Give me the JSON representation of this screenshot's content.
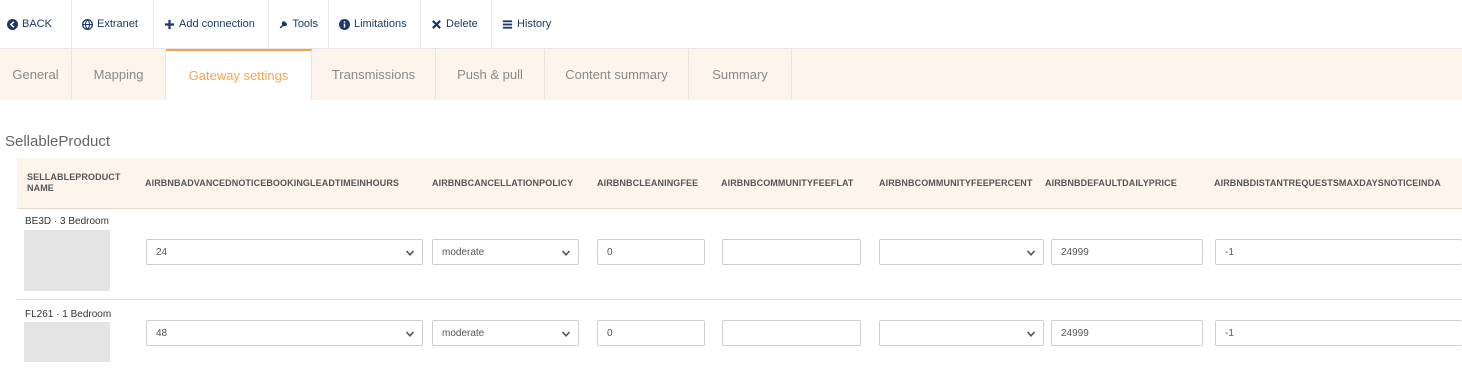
{
  "toolbar": {
    "back": "BACK",
    "extranet": "Extranet",
    "add_connection": "Add connection",
    "tools": "Tools",
    "limitations": "Limitations",
    "delete": "Delete",
    "history": "History"
  },
  "tabs": [
    "General",
    "Mapping",
    "Gateway settings",
    "Transmissions",
    "Push & pull",
    "Content summary",
    "Summary"
  ],
  "active_tab": "Gateway settings",
  "section_title": "SellableProduct",
  "columns": [
    "SELLABLEPRODUCT NAME",
    "AIRBNBADVANCEDNOTICEBOOKINGLEADTIMEINHOURS",
    "AIRBNBCANCELLATIONPOLICY",
    "AIRBNBCLEANINGFEE",
    "AIRBNBCOMMUNITYFEEFLAT",
    "AIRBNBCOMMUNITYFEEPERCENT",
    "AIRBNBDEFAULTDAILYPRICE",
    "AIRBNBDISTANTREQUESTSMAXDAYSNOTICEINDA"
  ],
  "rows": [
    {
      "name": "BE3D · 3 Bedroom",
      "lead_time": "24",
      "cancellation": "moderate",
      "cleaning_fee": "0",
      "community_fee_flat": "",
      "community_fee_percent": "",
      "default_daily_price": "24999",
      "distant_requests": "-1"
    },
    {
      "name": "FL261 · 1 Bedroom",
      "lead_time": "48",
      "cancellation": "moderate",
      "cleaning_fee": "0",
      "community_fee_flat": "",
      "community_fee_percent": "",
      "default_daily_price": "24999",
      "distant_requests": "-1"
    }
  ],
  "colors": {
    "accent": "#f4a54f",
    "toolbar_text": "#1b3a6b",
    "tab_bg": "#fdf5ec"
  }
}
